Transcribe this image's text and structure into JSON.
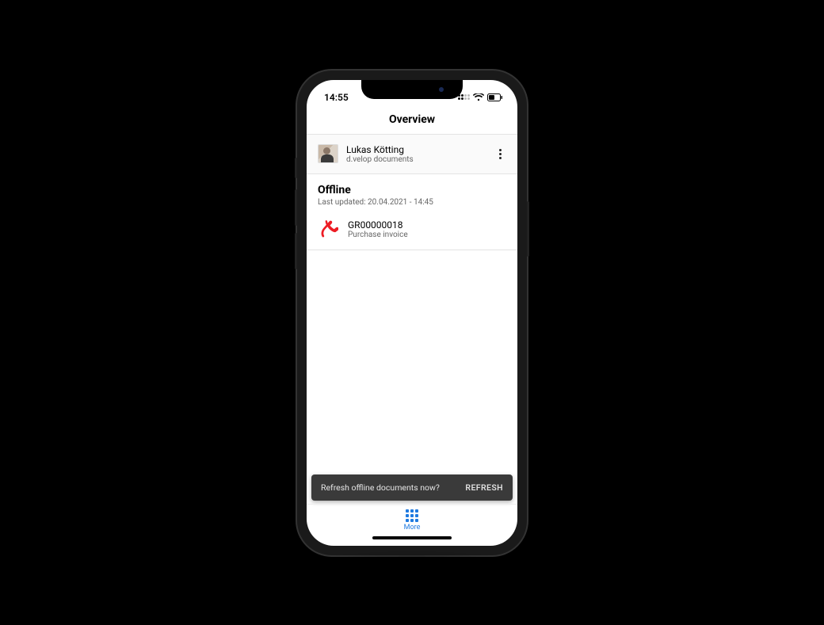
{
  "statusbar": {
    "time": "14:55"
  },
  "header": {
    "title": "Overview"
  },
  "user": {
    "name": "Lukas  Kötting",
    "subtitle": "d.velop documents"
  },
  "offline": {
    "title": "Offline",
    "last_updated": "Last updated: 20.04.2021 - 14:45",
    "documents": [
      {
        "title": "GR00000018",
        "subtitle": "Purchase invoice",
        "icon": "pdf-icon"
      }
    ]
  },
  "snackbar": {
    "message": "Refresh offline documents now?",
    "action": "REFRESH"
  },
  "bottomnav": {
    "label": "More"
  },
  "colors": {
    "accent": "#1f7ae0",
    "pdf": "#ed1c24"
  }
}
